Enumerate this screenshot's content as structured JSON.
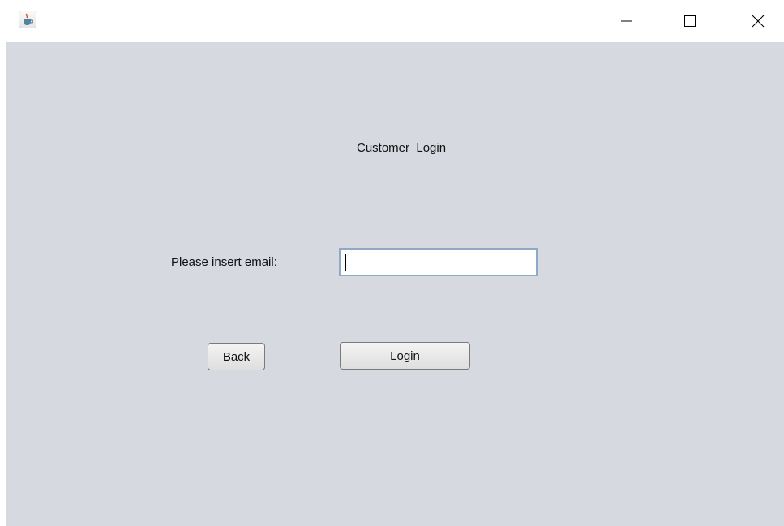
{
  "titlebar": {
    "app_icon": "java-coffee-icon",
    "controls": {
      "minimize_icon": "minimize-icon",
      "maximize_icon": "maximize-icon",
      "close_icon": "close-icon"
    }
  },
  "form": {
    "heading": "Customer  Login",
    "email_label": "Please insert email:",
    "email_value": "",
    "back_label": "Back",
    "login_label": "Login"
  },
  "colors": {
    "panel_background": "#d6d9e0",
    "input_border_focus": "#8fa9c8"
  }
}
